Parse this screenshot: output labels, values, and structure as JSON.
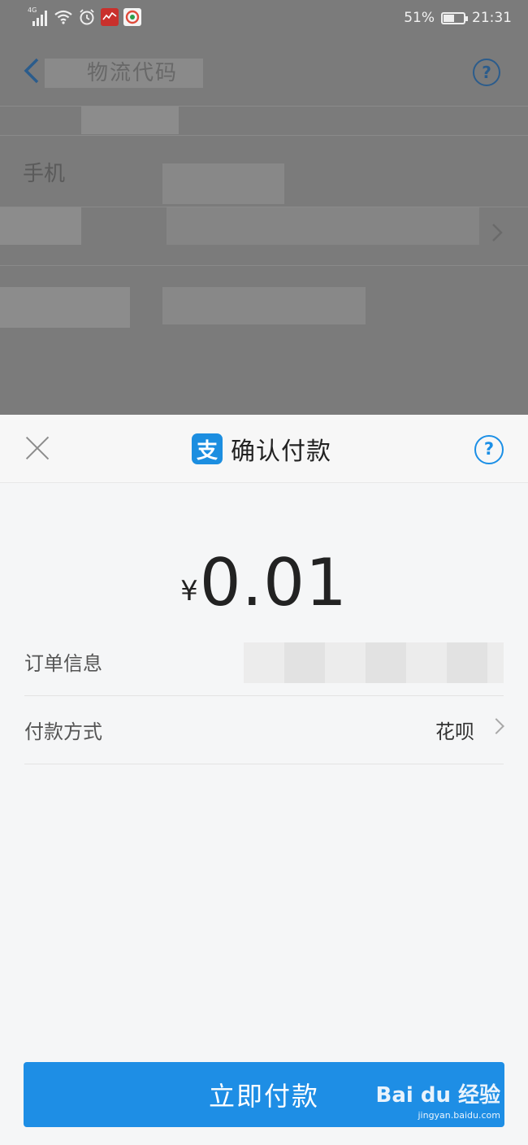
{
  "status_bar": {
    "network": "4G",
    "battery_percent": "51%",
    "time": "21:31"
  },
  "background_page": {
    "labels": [
      "手机"
    ],
    "title_fragment": "物流代码"
  },
  "payment_sheet": {
    "title": "确认付款",
    "help_symbol": "?",
    "logo_glyph": "支",
    "currency": "¥",
    "amount": "0.01",
    "order_info_label": "订单信息",
    "payment_method_label": "付款方式",
    "payment_method_value": "花呗",
    "pay_button": "立即付款"
  },
  "watermark": {
    "brand": "Bai du 经验",
    "url": "jingyan.baidu.com"
  },
  "colors": {
    "accent": "#1e8ee5",
    "overlay": "#7b7b7b",
    "sheet_bg": "#f5f6f7"
  }
}
